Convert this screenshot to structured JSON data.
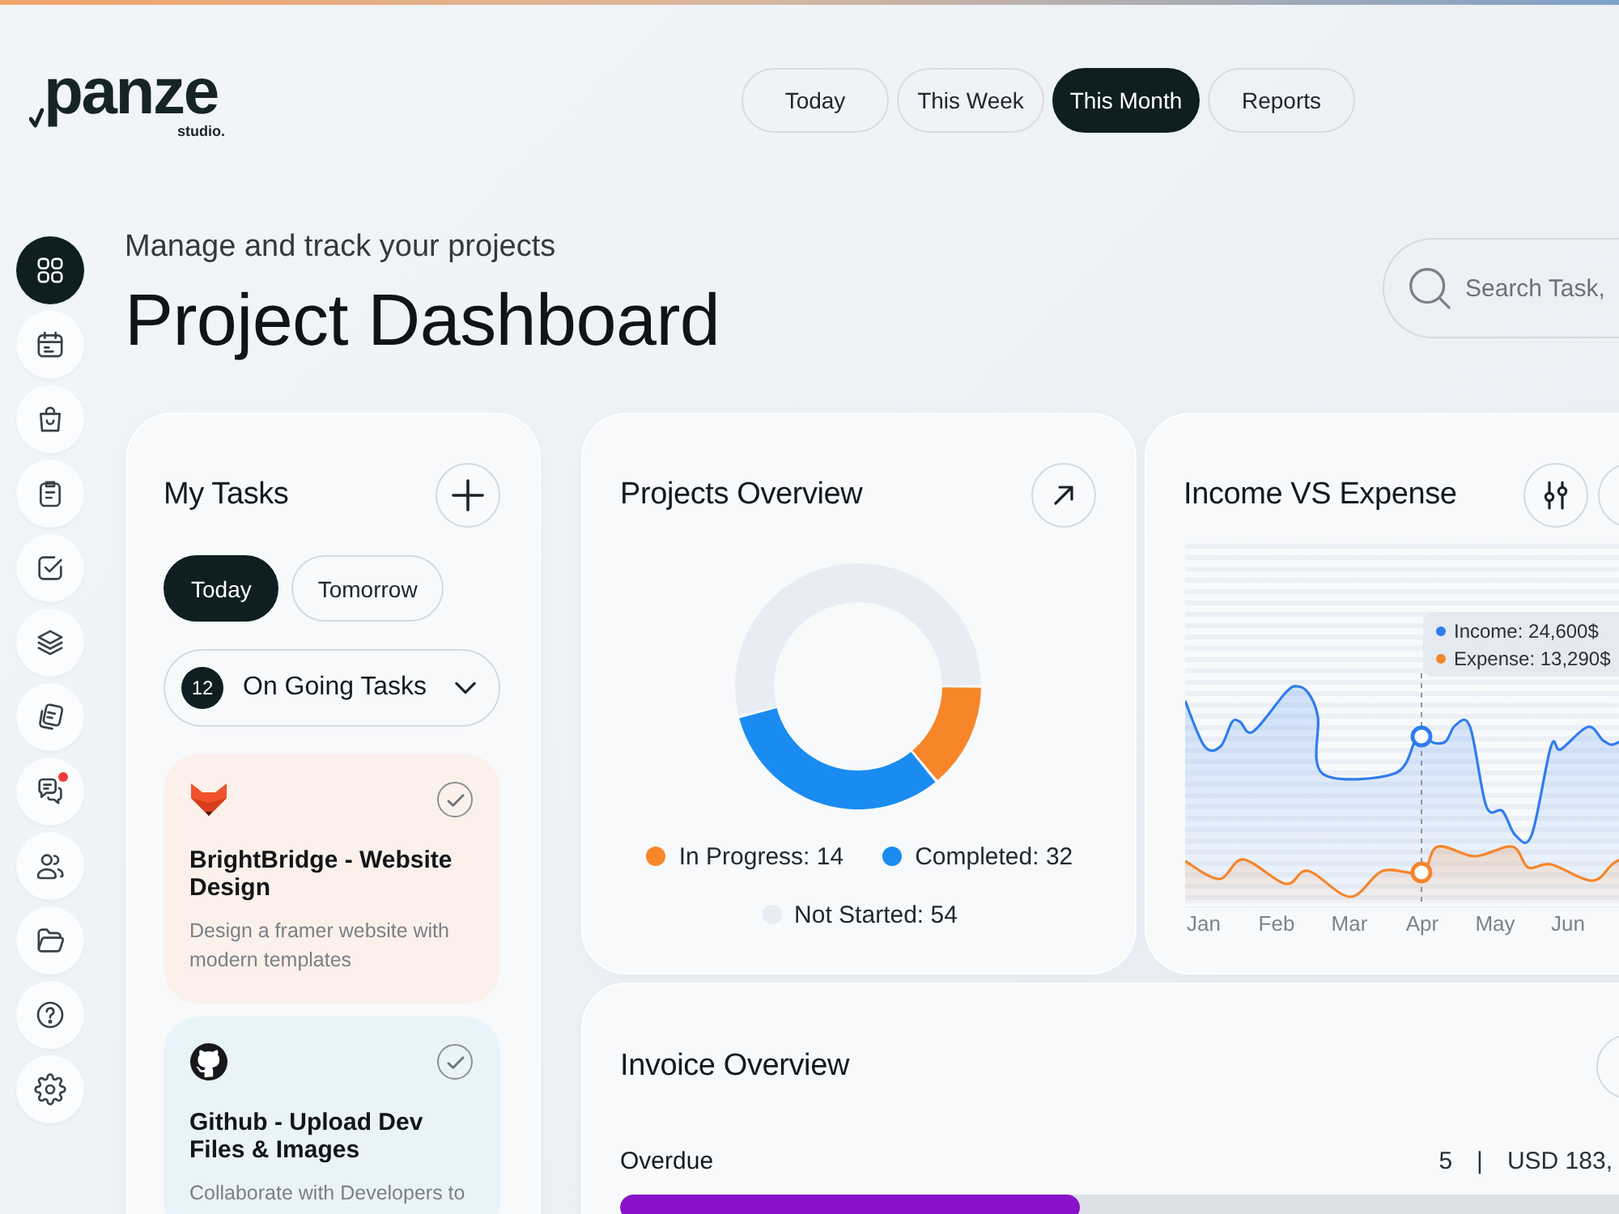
{
  "logo": {
    "name": "panze",
    "tagline": "studio."
  },
  "top_tabs": [
    {
      "label": "Today",
      "selected": false
    },
    {
      "label": "This Week",
      "selected": false
    },
    {
      "label": "This Month",
      "selected": true
    },
    {
      "label": "Reports",
      "selected": false
    }
  ],
  "sidebar": {
    "items": [
      {
        "selected": true,
        "unread": false
      },
      {
        "selected": false,
        "unread": false
      },
      {
        "selected": false,
        "unread": false
      },
      {
        "selected": false,
        "unread": false
      },
      {
        "selected": false,
        "unread": false
      },
      {
        "selected": false,
        "unread": false
      },
      {
        "selected": false,
        "unread": false
      },
      {
        "selected": false,
        "unread": true
      },
      {
        "selected": false,
        "unread": false
      },
      {
        "selected": false,
        "unread": false
      },
      {
        "selected": false,
        "unread": false
      },
      {
        "selected": false,
        "unread": false
      }
    ]
  },
  "header": {
    "subtitle": "Manage and track your projects",
    "title": "Project Dashboard"
  },
  "search": {
    "placeholder": "Search Task,"
  },
  "my_tasks": {
    "title": "My Tasks",
    "filters": [
      {
        "label": "Today",
        "selected": true
      },
      {
        "label": "Tomorrow",
        "selected": false
      }
    ],
    "dropdown": {
      "count": "12",
      "label": "On Going Tasks"
    },
    "tasks": [
      {
        "title": "BrightBridge - Website Design",
        "description": "Design a framer website with modern templates",
        "color": "#fcf0ea"
      },
      {
        "title": "Github - Upload Dev Files & Images",
        "description": "Collaborate with Developers to",
        "color": "#e9f3fa"
      }
    ]
  },
  "projects_overview": {
    "title": "Projects Overview",
    "chart_data": {
      "type": "donut",
      "values": [
        14,
        32,
        54
      ]
    },
    "legend": [
      {
        "label": "In Progress: 14",
        "color": "#f7862a"
      },
      {
        "label": "Completed: 32",
        "color": "#1a8cf1"
      },
      {
        "label": "Not Started: 54",
        "color": "#e8ecf3"
      }
    ]
  },
  "income_expense": {
    "title": "Income VS Expense",
    "tooltip": [
      {
        "label": "Income: 24,600$",
        "color": "#2f7cf0"
      },
      {
        "label": "Expense: 13,290$",
        "color": "#f5852b"
      }
    ],
    "months": [
      "Jan",
      "Feb",
      "Mar",
      "Apr",
      "May",
      "Jun"
    ]
  },
  "invoice_overview": {
    "title": "Invoice Overview",
    "rows": [
      {
        "label": "Overdue",
        "count": "5",
        "separator": "|",
        "amount": "USD 183,",
        "level": 0.45
      }
    ]
  }
}
